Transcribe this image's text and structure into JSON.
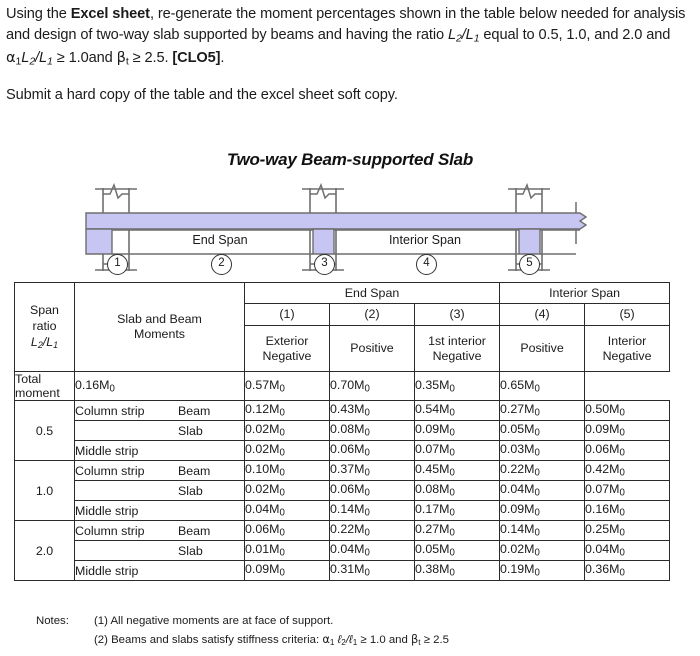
{
  "question": {
    "line1_a": "Using the ",
    "line1_bold": "Excel sheet",
    "line1_b": ", re-generate the moment percentages shown in the table below needed for analysis and design of two-way slab supported by beams and having the ratio ",
    "ratio_sym_L": "L",
    "ratio_sub2": "2",
    "ratio_slash": "/L",
    "ratio_sub1": "1",
    "line1_c": " equal to 0.5, 1.0, and 2.0 and ",
    "alpha": "α",
    "alpha_sub": "1",
    "line1_d": " ≥ 1.0and ",
    "beta": "β",
    "beta_sub": "t",
    "line1_e": " ≥  2.5. ",
    "clo": "[CLO5]",
    "line1_f": ".",
    "para2": "Submit a hard copy of the table and the excel sheet soft copy."
  },
  "figure": {
    "title": "Two-way Beam-supported Slab",
    "end_span_label": "End Span",
    "interior_span_label": "Interior Span",
    "markers": [
      "1",
      "2",
      "3",
      "4",
      "5"
    ],
    "slab_color": "#c7c5f2",
    "line_color": "#6e6e6e"
  },
  "table": {
    "header": {
      "span_ratio_l1": "Span",
      "span_ratio_l2": "ratio",
      "span_ratio_sym": "L",
      "span_ratio_sub2": "2",
      "span_ratio_slash": "/L",
      "span_ratio_sub1": "1",
      "moments_l1": "Slab and Beam",
      "moments_l2": "Moments",
      "group_end_span": "End Span",
      "group_interior_span": "Interior Span",
      "col_numbers": [
        "(1)",
        "(2)",
        "(3)",
        "(4)",
        "(5)"
      ],
      "col_names": [
        [
          "Exterior",
          "Negative"
        ],
        [
          "Positive",
          ""
        ],
        [
          "1st interior",
          "Negative"
        ],
        [
          "Positive",
          ""
        ],
        [
          "Interior",
          "Negative"
        ]
      ]
    },
    "total_row": {
      "label": "Total moment",
      "values": [
        "0.16M",
        "0.57M",
        "0.70M",
        "0.35M",
        "0.65M"
      ]
    },
    "m0_sub": "0",
    "groups": [
      {
        "ratio": "0.5",
        "rows": [
          {
            "label_left": "Column strip",
            "label_right": "Beam",
            "values": [
              "0.12M",
              "0.43M",
              "0.54M",
              "0.27M",
              "0.50M"
            ]
          },
          {
            "label_left": "",
            "label_right": "Slab",
            "values": [
              "0.02M",
              "0.08M",
              "0.09M",
              "0.05M",
              "0.09M"
            ]
          },
          {
            "label_left": "Middle strip",
            "label_right": "",
            "values": [
              "0.02M",
              "0.06M",
              "0.07M",
              "0.03M",
              "0.06M"
            ]
          }
        ]
      },
      {
        "ratio": "1.0",
        "rows": [
          {
            "label_left": "Column strip",
            "label_right": "Beam",
            "values": [
              "0.10M",
              "0.37M",
              "0.45M",
              "0.22M",
              "0.42M"
            ]
          },
          {
            "label_left": "",
            "label_right": "Slab",
            "values": [
              "0.02M",
              "0.06M",
              "0.08M",
              "0.04M",
              "0.07M"
            ]
          },
          {
            "label_left": "Middle strip",
            "label_right": "",
            "values": [
              "0.04M",
              "0.14M",
              "0.17M",
              "0.09M",
              "0.16M"
            ]
          }
        ]
      },
      {
        "ratio": "2.0",
        "rows": [
          {
            "label_left": "Column strip",
            "label_right": "Beam",
            "values": [
              "0.06M",
              "0.22M",
              "0.27M",
              "0.14M",
              "0.25M"
            ]
          },
          {
            "label_left": "",
            "label_right": "Slab",
            "values": [
              "0.01M",
              "0.04M",
              "0.05M",
              "0.02M",
              "0.04M"
            ]
          },
          {
            "label_left": "Middle strip",
            "label_right": "",
            "values": [
              "0.09M",
              "0.31M",
              "0.38M",
              "0.19M",
              "0.36M"
            ]
          }
        ]
      }
    ]
  },
  "notes": {
    "label": "Notes:",
    "note1": "(1) All negative moments are at face of support.",
    "note2_a": "(2) Beams and slabs satisfy stiffness criteria: ",
    "note2_alpha": "α",
    "note2_alpha_sub": "1",
    "note2_l2": " ℓ",
    "note2_l2_sub": "2",
    "note2_slash": "/ℓ",
    "note2_l1_sub": "1",
    "note2_ge1": " ≥ 1.0 and ",
    "note2_beta": "β",
    "note2_beta_sub": "t",
    "note2_ge2": " ≥ 2.5"
  }
}
